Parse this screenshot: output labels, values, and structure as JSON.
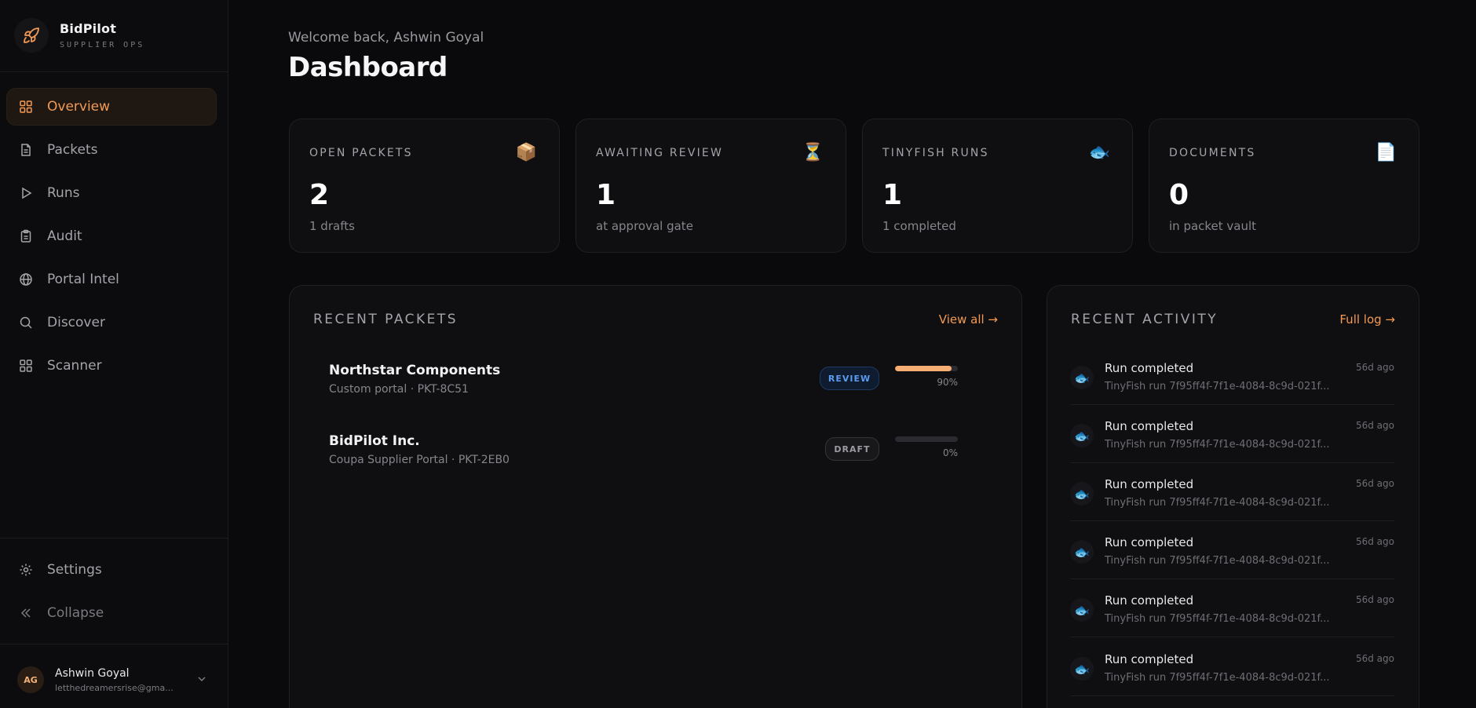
{
  "brand": {
    "name": "BidPilot",
    "subtitle": "SUPPLIER OPS"
  },
  "nav": {
    "items": [
      {
        "label": "Overview",
        "icon": "grid-icon",
        "active": true
      },
      {
        "label": "Packets",
        "icon": "document-icon"
      },
      {
        "label": "Runs",
        "icon": "play-icon"
      },
      {
        "label": "Audit",
        "icon": "clipboard-icon"
      },
      {
        "label": "Portal Intel",
        "icon": "globe-icon"
      },
      {
        "label": "Discover",
        "icon": "search-icon"
      },
      {
        "label": "Scanner",
        "icon": "grid-icon"
      }
    ],
    "settings": "Settings",
    "collapse": "Collapse"
  },
  "user": {
    "initials": "AG",
    "name": "Ashwin Goyal",
    "email": "letthedreamersrise@gma..."
  },
  "header": {
    "welcome": "Welcome back, Ashwin Goyal",
    "title": "Dashboard"
  },
  "stats": [
    {
      "label": "OPEN PACKETS",
      "icon": "📦",
      "value": "2",
      "sub": "1 drafts"
    },
    {
      "label": "AWAITING REVIEW",
      "icon": "⏳",
      "value": "1",
      "sub": "at approval gate"
    },
    {
      "label": "TINYFISH RUNS",
      "icon": "🐟",
      "value": "1",
      "sub": "1 completed"
    },
    {
      "label": "DOCUMENTS",
      "icon": "📄",
      "value": "0",
      "sub": "in packet vault"
    }
  ],
  "recent_packets": {
    "title": "RECENT PACKETS",
    "link": "View all →",
    "items": [
      {
        "name": "Northstar Components",
        "meta": "Custom portal · PKT-8C51",
        "status": "REVIEW",
        "progress": 90,
        "progress_label": "90%"
      },
      {
        "name": "BidPilot Inc.",
        "meta": "Coupa Supplier Portal · PKT-2EB0",
        "status": "DRAFT",
        "progress": 0,
        "progress_label": "0%"
      }
    ]
  },
  "recent_activity": {
    "title": "RECENT ACTIVITY",
    "link": "Full log →",
    "items": [
      {
        "title": "Run completed",
        "desc": "TinyFish run 7f95ff4f-7f1e-4084-8c9d-021f...",
        "time": "56d ago"
      },
      {
        "title": "Run completed",
        "desc": "TinyFish run 7f95ff4f-7f1e-4084-8c9d-021f...",
        "time": "56d ago"
      },
      {
        "title": "Run completed",
        "desc": "TinyFish run 7f95ff4f-7f1e-4084-8c9d-021f...",
        "time": "56d ago"
      },
      {
        "title": "Run completed",
        "desc": "TinyFish run 7f95ff4f-7f1e-4084-8c9d-021f...",
        "time": "56d ago"
      },
      {
        "title": "Run completed",
        "desc": "TinyFish run 7f95ff4f-7f1e-4084-8c9d-021f...",
        "time": "56d ago"
      },
      {
        "title": "Run completed",
        "desc": "TinyFish run 7f95ff4f-7f1e-4084-8c9d-021f...",
        "time": "56d ago"
      }
    ]
  },
  "colors": {
    "accent": "#f39a54",
    "review": "#5a9cf0",
    "bg": "#0a0a0c"
  }
}
